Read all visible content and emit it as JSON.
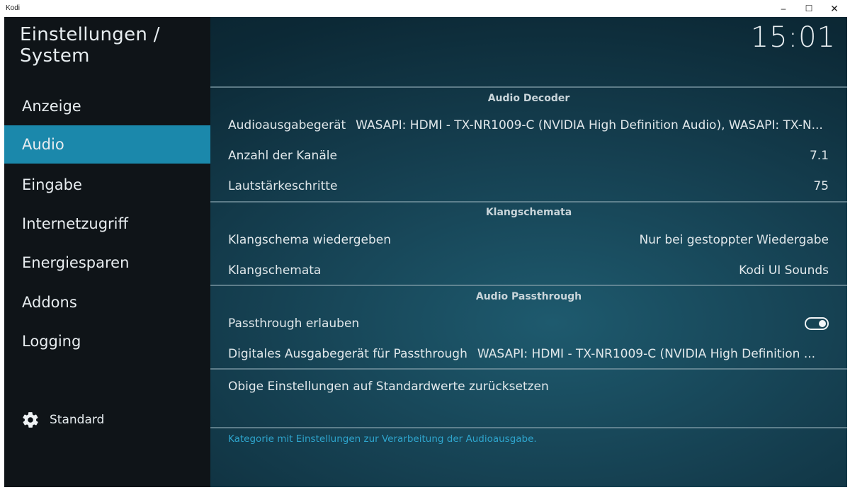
{
  "window": {
    "title": "Kodi",
    "minimize_glyph": "–",
    "maximize_glyph": "☐",
    "close_glyph": "✕"
  },
  "header": {
    "title": "Einstellungen / System",
    "clock": "15:01"
  },
  "sidebar": {
    "items": [
      {
        "label": "Anzeige",
        "active": false
      },
      {
        "label": "Audio",
        "active": true
      },
      {
        "label": "Eingabe",
        "active": false
      },
      {
        "label": "Internetzugriff",
        "active": false
      },
      {
        "label": "Energiesparen",
        "active": false
      },
      {
        "label": "Addons",
        "active": false
      },
      {
        "label": "Logging",
        "active": false
      }
    ],
    "level": {
      "label": "Standard",
      "icon": "gear-icon"
    }
  },
  "settings": {
    "sections": [
      {
        "title": "Audio Decoder",
        "rows": [
          {
            "label": "Audioausgabegerät",
            "value": "WASAPI: HDMI - TX-NR1009-C (NVIDIA High Definition Audio), WASAPI: TX-N..."
          },
          {
            "label": "Anzahl der Kanäle",
            "value": "7.1"
          },
          {
            "label": "Lautstärkeschritte",
            "value": "75"
          }
        ]
      },
      {
        "title": "Klangschemata",
        "rows": [
          {
            "label": "Klangschema wiedergeben",
            "value": "Nur bei gestoppter Wiedergabe"
          },
          {
            "label": "Klangschemata",
            "value": "Kodi UI Sounds"
          }
        ]
      },
      {
        "title": "Audio Passthrough",
        "rows": [
          {
            "label": "Passthrough erlauben",
            "toggle": true
          },
          {
            "label": "Digitales Ausgabegerät für Passthrough",
            "value": "WASAPI: HDMI - TX-NR1009-C (NVIDIA High Definition ..."
          }
        ]
      }
    ],
    "reset_label": "Obige Einstellungen auf Standardwerte zurücksetzen"
  },
  "description": "Kategorie mit Einstellungen zur Verarbeitung der Audioausgabe.",
  "colors": {
    "accent": "#1b88ab",
    "description_text": "#2ea4cc",
    "sidebar_bg": "#0f1418"
  }
}
